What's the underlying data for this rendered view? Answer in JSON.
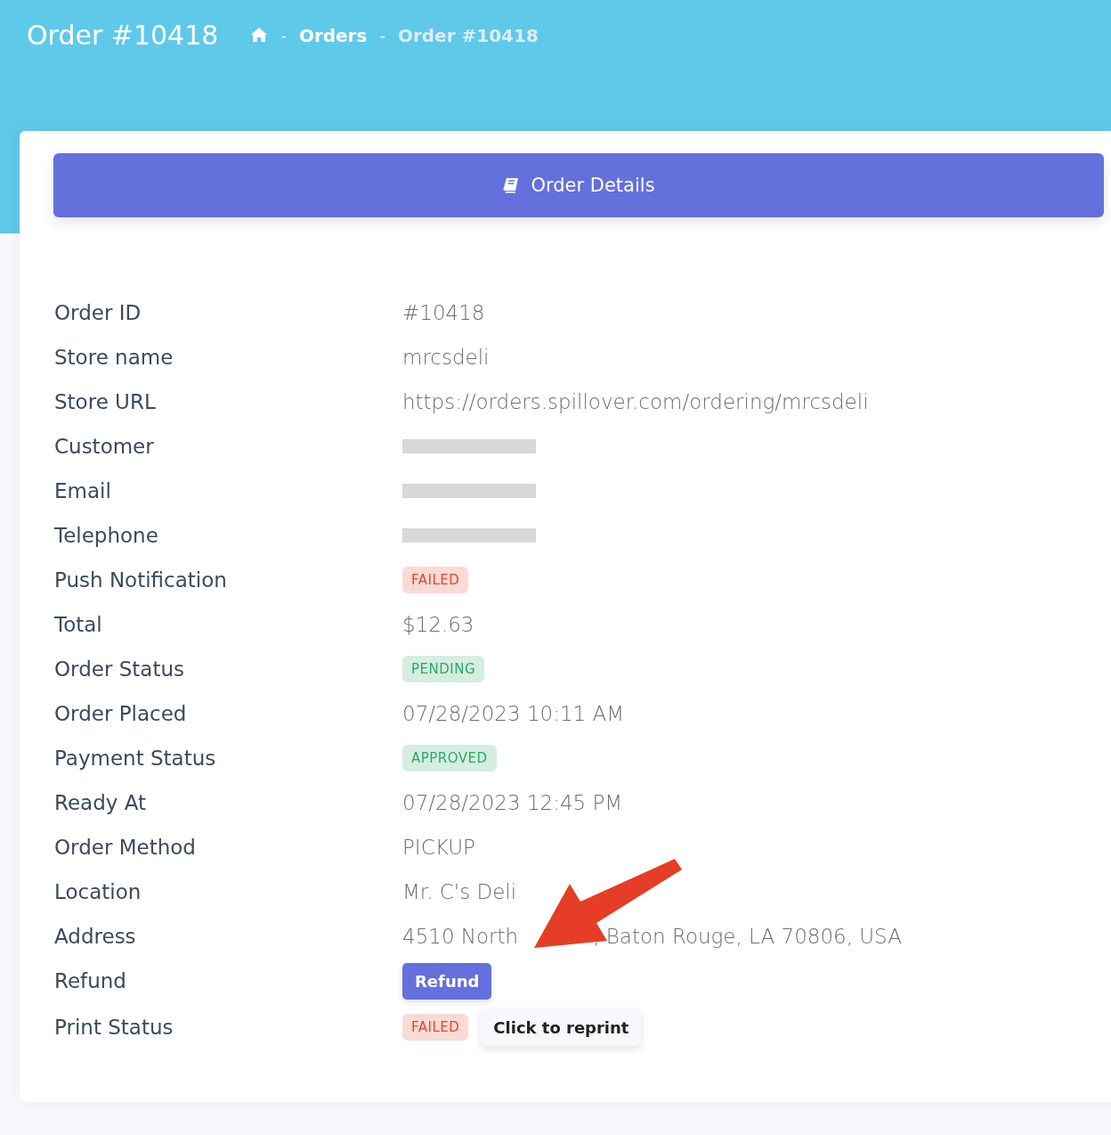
{
  "header": {
    "title": "Order #10418",
    "separator": "-",
    "breadcrumb": [
      {
        "kind": "home"
      },
      {
        "kind": "link",
        "label": "Orders"
      },
      {
        "kind": "current",
        "label": "Order #10418"
      }
    ]
  },
  "card": {
    "heading": "Order Details",
    "rows": [
      {
        "label": "Order ID",
        "kind": "text",
        "value": "#10418"
      },
      {
        "label": "Store name",
        "kind": "text",
        "value": "mrcsdeli"
      },
      {
        "label": "Store URL",
        "kind": "text",
        "value": "https://orders.spillover.com/ordering/mrcsdeli"
      },
      {
        "label": "Customer",
        "kind": "redacted"
      },
      {
        "label": "Email",
        "kind": "redacted"
      },
      {
        "label": "Telephone",
        "kind": "redacted"
      },
      {
        "label": "Push Notification",
        "kind": "badge",
        "value": "FAILED",
        "color": "#e8452a"
      },
      {
        "label": "Total",
        "kind": "text",
        "value": "$12.63"
      },
      {
        "label": "Order Status",
        "kind": "badge",
        "value": "PENDING",
        "color": "#2ca86a"
      },
      {
        "label": "Order Placed",
        "kind": "text",
        "value": "07/28/2023 10:11 AM"
      },
      {
        "label": "Payment Status",
        "kind": "badge",
        "value": "APPROVED",
        "color": "#2ca86a"
      },
      {
        "label": "Ready At",
        "kind": "text",
        "value": "07/28/2023 12:45 PM"
      },
      {
        "label": "Order Method",
        "kind": "text",
        "value": "PICKUP"
      },
      {
        "label": "Location",
        "kind": "text",
        "value": "Mr. C's Deli"
      },
      {
        "label": "Address",
        "kind": "split",
        "parts": [
          "4510 North",
          ", Baton Rouge, LA 70806, USA"
        ]
      },
      {
        "label": "Refund",
        "kind": "button",
        "value": "Refund"
      },
      {
        "label": "Print Status",
        "kind": "badge",
        "value": "FAILED",
        "color": "#e8452a",
        "action": "Click to reprint"
      }
    ]
  }
}
